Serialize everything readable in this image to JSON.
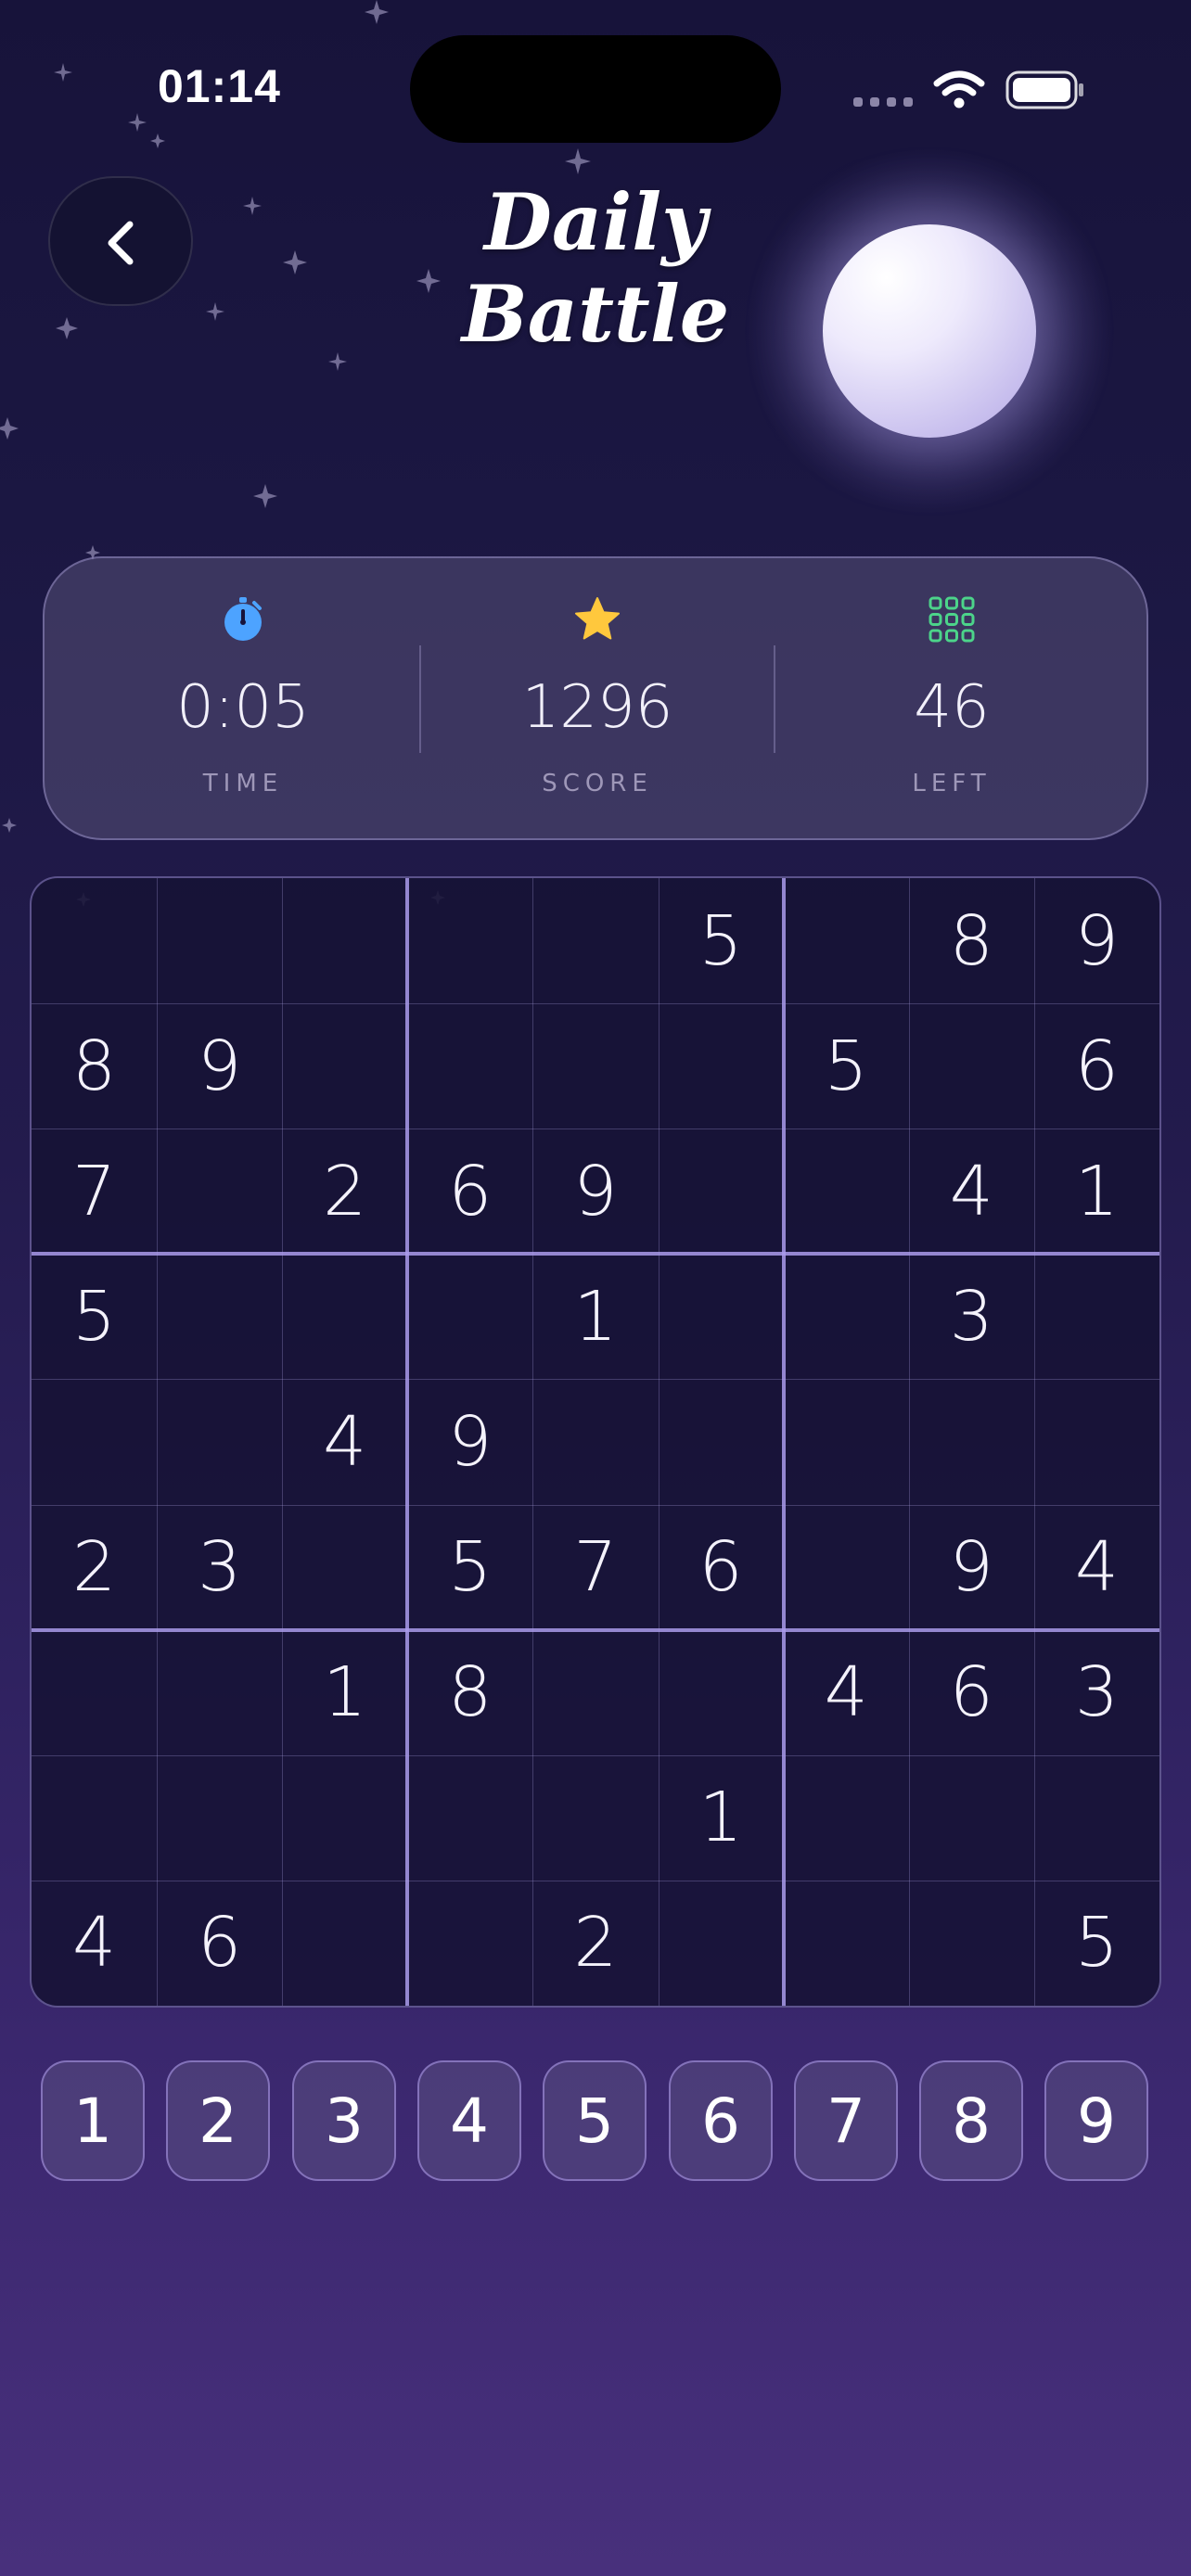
{
  "status_bar": {
    "time": "01:14"
  },
  "header": {
    "title": "Daily Battle",
    "back_icon": "chevron-left-icon"
  },
  "stats": [
    {
      "icon": "stopwatch-icon",
      "icon_color": "#4da3ff",
      "value": "0:05",
      "label": "TIME"
    },
    {
      "icon": "star-icon",
      "icon_color": "#ffc83d",
      "value": "1296",
      "label": "SCORE"
    },
    {
      "icon": "grid-icon",
      "icon_color": "#4cd48a",
      "value": "46",
      "label": "LEFT"
    }
  ],
  "board": {
    "rows": [
      [
        "",
        "",
        "",
        "",
        "",
        "5",
        "",
        "8",
        "9"
      ],
      [
        "8",
        "9",
        "",
        "",
        "",
        "",
        "5",
        "",
        "6"
      ],
      [
        "7",
        "",
        "2",
        "6",
        "9",
        "",
        "",
        "4",
        "1"
      ],
      [
        "5",
        "",
        "",
        "",
        "1",
        "",
        "",
        "3",
        ""
      ],
      [
        "",
        "",
        "4",
        "9",
        "",
        "",
        "",
        "",
        ""
      ],
      [
        "2",
        "3",
        "",
        "5",
        "7",
        "6",
        "",
        "9",
        "4"
      ],
      [
        "",
        "",
        "1",
        "8",
        "",
        "",
        "4",
        "6",
        "3"
      ],
      [
        "",
        "",
        "",
        "",
        "",
        "1",
        "",
        "",
        ""
      ],
      [
        "4",
        "6",
        "",
        "",
        "2",
        "",
        "",
        "",
        "5"
      ]
    ]
  },
  "numpad": [
    "1",
    "2",
    "3",
    "4",
    "5",
    "6",
    "7",
    "8",
    "9"
  ],
  "colors": {
    "background_top": "#17133a",
    "background_bottom": "#48307c",
    "accent_border": "#aa9beb"
  }
}
